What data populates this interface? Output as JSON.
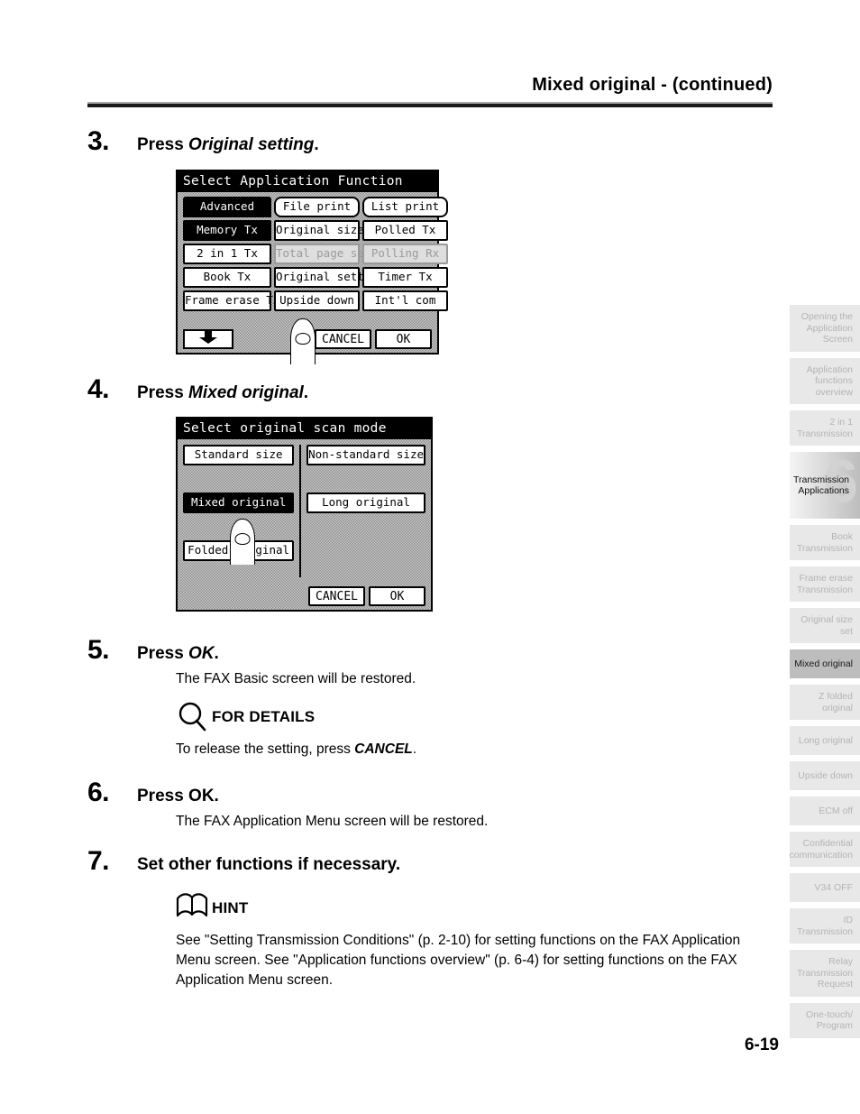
{
  "header": {
    "title": "Mixed original -  (continued)"
  },
  "footer": {
    "page_number": "6-19"
  },
  "steps": [
    {
      "number": "3.",
      "title_prefix": "Press ",
      "title_em": "Original setting",
      "title_suffix": "."
    },
    {
      "number": "4.",
      "title_prefix": "Press ",
      "title_em": "Mixed original",
      "title_suffix": "."
    },
    {
      "number": "5.",
      "title_prefix": "Press ",
      "title_em": "OK",
      "title_suffix": ".",
      "body": "The FAX Basic screen will be restored.",
      "callout_label": "FOR DETAILS",
      "callout_icon": "magnifier-icon",
      "callout_text_prefix": "To release the setting, press ",
      "callout_text_strong": "CANCEL",
      "callout_text_suffix": "."
    },
    {
      "number": "6.",
      "title_prefix": "Press OK.",
      "body": "The FAX Application Menu screen will be restored."
    },
    {
      "number": "7.",
      "title_prefix": "Set other functions if necessary.",
      "callout_label": "HINT",
      "callout_icon": "open-book-icon",
      "hint_text": "See \"Setting Transmission Conditions\" (p. 2-10) for setting functions on the FAX Application Menu screen.  See \"Application functions overview\" (p. 6-4) for setting functions on the FAX Application Menu screen."
    }
  ],
  "lcd_app_function": {
    "title": "Select Application Function",
    "tab_label": "Advanced",
    "keys": [
      {
        "label": "File print",
        "state": "normal"
      },
      {
        "label": "List print",
        "state": "normal"
      },
      {
        "label": "Memory Tx",
        "state": "selected"
      },
      {
        "label": "Original size set",
        "state": "normal"
      },
      {
        "label": "Polled Tx",
        "state": "normal"
      },
      {
        "label": "2 in 1 Tx",
        "state": "normal"
      },
      {
        "label": "Total page set",
        "state": "disabled"
      },
      {
        "label": "Polling Rx",
        "state": "disabled"
      },
      {
        "label": "Book Tx",
        "state": "normal"
      },
      {
        "label": "Original setting",
        "state": "normal"
      },
      {
        "label": "Timer Tx",
        "state": "normal"
      },
      {
        "label": "Frame erase Tx",
        "state": "normal"
      },
      {
        "label": "Upside down",
        "state": "normal"
      },
      {
        "label": "Int'l com",
        "state": "normal"
      }
    ],
    "scroll_icon": "down-arrow-icon",
    "cancel_label": "CANCEL",
    "ok_label": "OK"
  },
  "lcd_scan_mode": {
    "title": "Select original scan mode",
    "left_heading": "Standard size",
    "right_heading": "Non-standard size",
    "left_keys": [
      {
        "label": "Mixed original",
        "state": "selected"
      },
      {
        "label": "Folded original",
        "state": "normal"
      }
    ],
    "right_keys": [
      {
        "label": "Long original",
        "state": "normal"
      }
    ],
    "cancel_label": "CANCEL",
    "ok_label": "OK"
  },
  "index_tabs": [
    {
      "lines": [
        "Opening the",
        "Application",
        "Screen"
      ],
      "state": "normal"
    },
    {
      "lines": [
        "Application",
        "functions",
        "overview"
      ],
      "state": "normal"
    },
    {
      "lines": [
        "2 in 1",
        "Transmission"
      ],
      "state": "normal"
    },
    {
      "lines": [
        "Transmission",
        "Applications"
      ],
      "state": "chapter",
      "chapter_number": "6"
    },
    {
      "lines": [
        "Book",
        "Transmission"
      ],
      "state": "normal"
    },
    {
      "lines": [
        "Frame erase",
        "Transmission"
      ],
      "state": "normal"
    },
    {
      "lines": [
        "Original size set"
      ],
      "state": "normal"
    },
    {
      "lines": [
        "Mixed original"
      ],
      "state": "current"
    },
    {
      "lines": [
        "Z folded original"
      ],
      "state": "normal"
    },
    {
      "lines": [
        "Long original"
      ],
      "state": "normal"
    },
    {
      "lines": [
        "Upside down"
      ],
      "state": "normal"
    },
    {
      "lines": [
        "ECM off"
      ],
      "state": "normal"
    },
    {
      "lines": [
        "Confidential",
        "communication"
      ],
      "state": "normal"
    },
    {
      "lines": [
        "V34 OFF"
      ],
      "state": "normal"
    },
    {
      "lines": [
        "ID",
        "Transmission"
      ],
      "state": "normal"
    },
    {
      "lines": [
        "Relay",
        "Transmission",
        "Request"
      ],
      "state": "normal"
    },
    {
      "lines": [
        "One-touch/",
        "Program"
      ],
      "state": "normal"
    }
  ],
  "colors": {
    "tab_inactive_bg": "#e8e8e8",
    "tab_inactive_text": "#b4b4b4",
    "tab_current_bg": "#bdbdbd",
    "rule_dark": "#1a1a1a",
    "rule_light": "#a9a9a9"
  }
}
